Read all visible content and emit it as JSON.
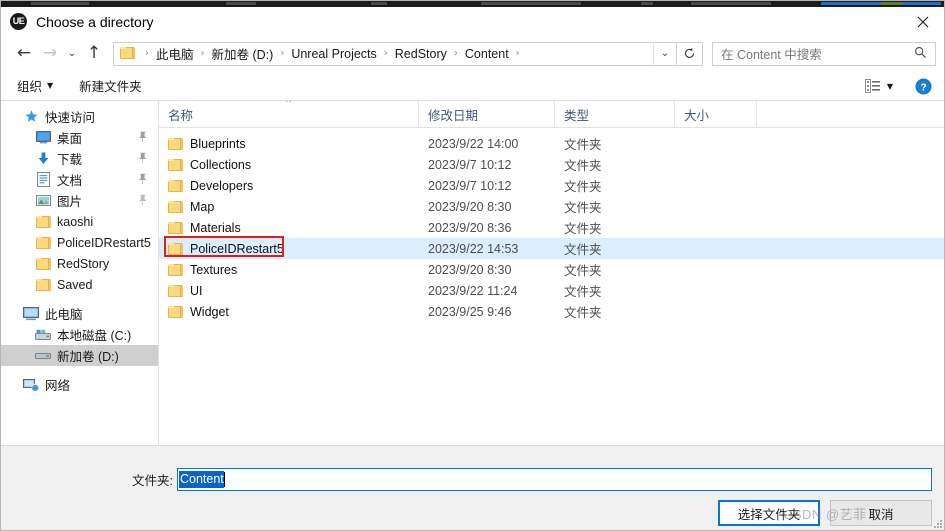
{
  "window": {
    "title": "Choose a directory",
    "app_icon": "unreal-engine-icon",
    "app_icon_text": "UE",
    "close_icon": "close-icon"
  },
  "nav": {
    "back": "back-arrow-icon",
    "forward": "forward-arrow-icon",
    "recent": "chevron-down-icon",
    "up": "up-arrow-icon",
    "refresh": "refresh-icon",
    "breadcrumbs": [
      "此电脑",
      "新加卷 (D:)",
      "Unreal Projects",
      "RedStory",
      "Content"
    ],
    "separator": "›"
  },
  "search": {
    "placeholder": "在 Content 中搜索",
    "icon": "search-icon"
  },
  "toolbar": {
    "organize_label": "组织",
    "new_folder_label": "新建文件夹",
    "view_icon": "view-options-icon",
    "view_caret": "chevron-down-icon",
    "help_icon": "help-icon",
    "help_glyph": "?"
  },
  "sidebar": {
    "items": [
      {
        "label": "快速访问",
        "icon": "star-icon",
        "level": 0,
        "pinned": false,
        "selected": false
      },
      {
        "label": "桌面",
        "icon": "desktop-icon",
        "level": 1,
        "pinned": true,
        "selected": false
      },
      {
        "label": "下载",
        "icon": "downloads-icon",
        "level": 1,
        "pinned": true,
        "selected": false
      },
      {
        "label": "文档",
        "icon": "documents-icon",
        "level": 1,
        "pinned": true,
        "selected": false
      },
      {
        "label": "图片",
        "icon": "pictures-icon",
        "level": 1,
        "pinned": true,
        "selected": false
      },
      {
        "label": "kaoshi",
        "icon": "folder-icon",
        "level": 1,
        "pinned": false,
        "selected": false
      },
      {
        "label": "PoliceIDRestart5",
        "icon": "folder-icon",
        "level": 1,
        "pinned": false,
        "selected": false
      },
      {
        "label": "RedStory",
        "icon": "folder-icon",
        "level": 1,
        "pinned": false,
        "selected": false
      },
      {
        "label": "Saved",
        "icon": "folder-icon",
        "level": 1,
        "pinned": false,
        "selected": false
      },
      {
        "label": "此电脑",
        "icon": "this-pc-icon",
        "level": 0,
        "pinned": false,
        "selected": false
      },
      {
        "label": "本地磁盘 (C:)",
        "icon": "hard-drive-icon",
        "level": 1,
        "pinned": false,
        "selected": false
      },
      {
        "label": "新加卷 (D:)",
        "icon": "drive-icon",
        "level": 1,
        "pinned": false,
        "selected": true
      },
      {
        "label": "网络",
        "icon": "network-icon",
        "level": 0,
        "pinned": false,
        "selected": false
      }
    ]
  },
  "filelist": {
    "columns": [
      {
        "key": "name",
        "label": "名称",
        "sorted": "asc"
      },
      {
        "key": "date",
        "label": "修改日期",
        "sorted": ""
      },
      {
        "key": "type",
        "label": "类型",
        "sorted": ""
      },
      {
        "key": "size",
        "label": "大小",
        "sorted": ""
      }
    ],
    "rows": [
      {
        "name": "Blueprints",
        "date": "2023/9/22 14:00",
        "type": "文件夹",
        "size": "",
        "selected": false,
        "annotated": false
      },
      {
        "name": "Collections",
        "date": "2023/9/7 10:12",
        "type": "文件夹",
        "size": "",
        "selected": false,
        "annotated": false
      },
      {
        "name": "Developers",
        "date": "2023/9/7 10:12",
        "type": "文件夹",
        "size": "",
        "selected": false,
        "annotated": false
      },
      {
        "name": "Map",
        "date": "2023/9/20 8:30",
        "type": "文件夹",
        "size": "",
        "selected": false,
        "annotated": false
      },
      {
        "name": "Materials",
        "date": "2023/9/20 8:36",
        "type": "文件夹",
        "size": "",
        "selected": false,
        "annotated": false
      },
      {
        "name": "PoliceIDRestart5",
        "date": "2023/9/22 14:53",
        "type": "文件夹",
        "size": "",
        "selected": true,
        "annotated": true
      },
      {
        "name": "Textures",
        "date": "2023/9/20 8:30",
        "type": "文件夹",
        "size": "",
        "selected": false,
        "annotated": false
      },
      {
        "name": "UI",
        "date": "2023/9/22 11:24",
        "type": "文件夹",
        "size": "",
        "selected": false,
        "annotated": false
      },
      {
        "name": "Widget",
        "date": "2023/9/25 9:46",
        "type": "文件夹",
        "size": "",
        "selected": false,
        "annotated": false
      }
    ]
  },
  "footer": {
    "folder_label": "文件夹:",
    "folder_value": "Content",
    "select_button": "选择文件夹",
    "cancel_button": "取消"
  },
  "watermark": {
    "text": "CSDN @艺菲"
  },
  "colors": {
    "accent": "#0078d7",
    "selection_row": "#dbeeff",
    "annotation": "#e02020",
    "header_text": "#42577b",
    "folder_yellow": "#fcd97f"
  }
}
